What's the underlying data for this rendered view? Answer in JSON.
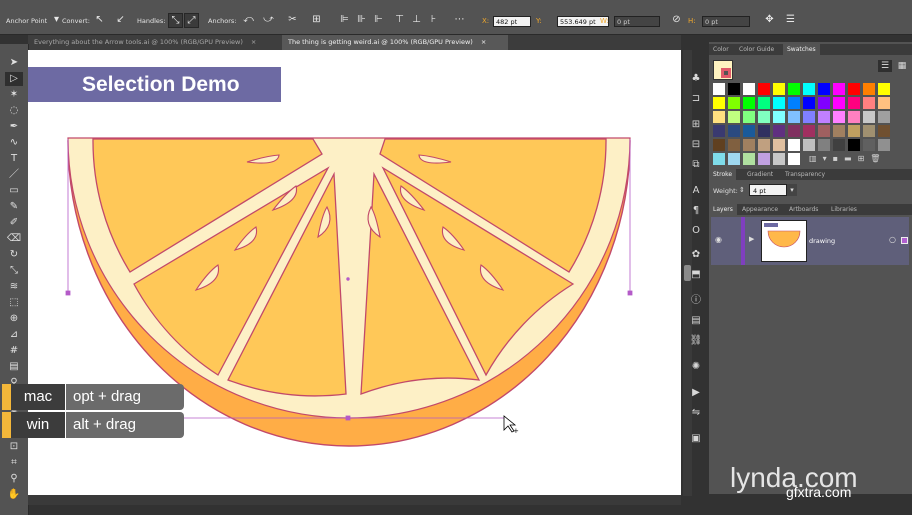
{
  "control_bar": {
    "anchor_point_label": "Anchor Point",
    "convert_label": "Convert:",
    "handles_label": "Handles:",
    "anchors_label": "Anchors:",
    "x_label": "X:",
    "x_value": "482 pt",
    "y_label": "Y:",
    "y_value": "553.649 pt",
    "w_label": "W:",
    "w_value": "0 pt",
    "h_label": "H:",
    "h_value": "0 pt"
  },
  "tabs": [
    {
      "label": "Everything about the Arrow tools.ai @ 100% (RGB/GPU Preview)",
      "close": "×"
    },
    {
      "label": "The thing is getting weird.ai @ 100% (RGB/GPU Preview)",
      "close": "×"
    }
  ],
  "canvas": {
    "banner": "Selection Demo"
  },
  "shortcut_overlay": {
    "rows": [
      {
        "os": "mac",
        "keys": "opt + drag"
      },
      {
        "os": "win",
        "keys": "alt + drag"
      }
    ]
  },
  "panels": {
    "swatch_tabs": [
      "Color",
      "Color Guide",
      "Swatches"
    ],
    "stroke_tabs": [
      "Stroke",
      "Gradient",
      "Transparency"
    ],
    "weight_label": "Weight:",
    "weight_value": "4 pt",
    "layer_tabs": [
      "Layers",
      "Appearance",
      "Artboards",
      "Libraries"
    ],
    "layer_name": "drawing"
  },
  "watermark": "lynda.com",
  "site_watermark": "gfxtra.com",
  "colors": {
    "banner": "#6d6aa3",
    "orange_rind": "#ffad46",
    "orange_flesh": "#ffc858",
    "pith": "#fdf0c6",
    "outline": "#c2496a",
    "selection": "#b45bc8",
    "overlay_accent": "#f3b73a"
  },
  "swatch_grid": [
    [
      "#ffffff",
      "#000000",
      "#ffffff",
      "#ff0000",
      "#ffff00",
      "#00ff00",
      "#00ffff",
      "#0000ff",
      "#ff00ff",
      "#ff0000",
      "#ff7f00",
      "#ffff00"
    ],
    [
      "#ffff00",
      "#80ff00",
      "#00ff00",
      "#00ff80",
      "#00ffff",
      "#0080ff",
      "#0000ff",
      "#8000ff",
      "#ff00ff",
      "#ff0080",
      "#ff8080",
      "#ffc080"
    ],
    [
      "#ffe080",
      "#c0ff80",
      "#80ff80",
      "#80ffc0",
      "#80ffff",
      "#80c0ff",
      "#8080ff",
      "#c080ff",
      "#ff80ff",
      "#ff80c0",
      "#c8c8c8",
      "#a0a0a0"
    ],
    [
      "#3a3a70",
      "#2a4a80",
      "#1a5a9a",
      "#303060",
      "#603080",
      "#803060",
      "#a03060",
      "#a06060",
      "#a08060",
      "#c0a060",
      "#a09070",
      "#705030"
    ],
    [
      "#604020",
      "#806040",
      "#a08060",
      "#c0a080",
      "#e0c0a0",
      "#ffffff",
      "#c0c0c0",
      "#808080",
      "#404040",
      "#000000",
      "#606060",
      "#909090"
    ],
    [
      "#7fdcea",
      "#9fd8f0",
      "#b0e0a0",
      "#c0a0e0",
      "#c8c8c8",
      "#ffffff"
    ]
  ]
}
